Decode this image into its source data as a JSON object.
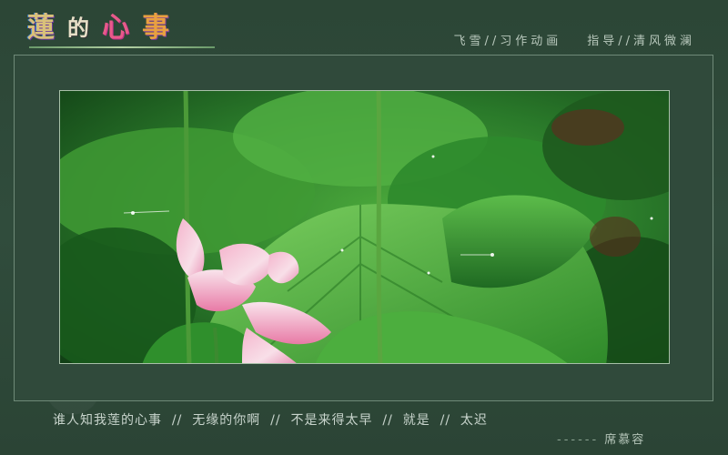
{
  "logo": {
    "char1": "蓮",
    "char2": "的",
    "char3": "心",
    "char4": "事"
  },
  "credits": {
    "left": "飞雪//习作动画",
    "right": "指导//清风微澜"
  },
  "poem": {
    "text": "谁人知我莲的心事  //  无缘的你啊  //  不是来得太早  //  就是  //  太迟"
  },
  "author": {
    "dashes": "------",
    "name": "席慕容"
  },
  "photo": {
    "subject": "pink-lotus-flower-image"
  }
}
